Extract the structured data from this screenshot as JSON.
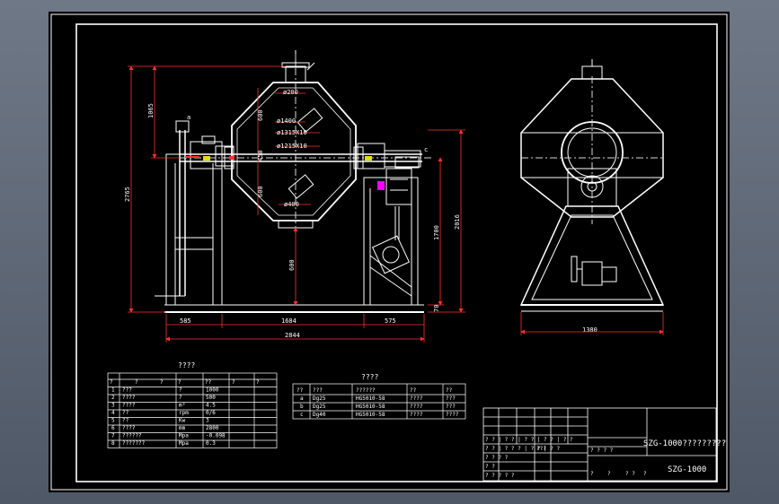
{
  "drawing": {
    "colors": {
      "background": "#000000",
      "frame": "#ffffff",
      "line": "#ffffff",
      "dim": "#ff3030",
      "accent": "#ff00ff",
      "center": "#d8d8d8"
    },
    "dimensions": {
      "d_top": "ø200",
      "d_140": "ø1400",
      "d_1315": "ø1315X10",
      "d_1215": "ø1215X10",
      "d_bottom": "ø400",
      "v_1065": "1065",
      "v_2765": "2765",
      "v_600a": "600",
      "v_450": "450",
      "v_600b": "600",
      "v_600c": "600",
      "v_1700": "1700",
      "v_2016": "2016",
      "v_70": "70",
      "h_585": "585",
      "h_1684": "1684",
      "h_575": "575",
      "h_2844": "2844",
      "h_1380": "1380",
      "tag_a": "a",
      "tag_c": "c"
    }
  },
  "specs_table": {
    "title": "????",
    "header": [
      "?",
      "?",
      "?",
      "?",
      "??",
      "?",
      "?"
    ],
    "rows": [
      [
        "1",
        "???",
        "?",
        "1000",
        "",
        ""
      ],
      [
        "2",
        "????",
        "?",
        "500",
        "",
        ""
      ],
      [
        "3",
        "????",
        "m³",
        "4.5",
        "",
        ""
      ],
      [
        "4",
        "??",
        "rpm",
        "0/6",
        "",
        ""
      ],
      [
        "5",
        "??",
        "Kw",
        "3",
        "",
        ""
      ],
      [
        "6",
        "????",
        "mm",
        "2800",
        "",
        ""
      ],
      [
        "7",
        "??????",
        "Mpa",
        "-0.098",
        "",
        ""
      ],
      [
        "8",
        "???????",
        "Mpa",
        "0.3",
        "",
        ""
      ]
    ]
  },
  "nozzle_table": {
    "title": "????",
    "header": [
      "??",
      "???",
      "??????",
      "??",
      "??"
    ],
    "rows": [
      [
        "a",
        "Dg25",
        "HG5010-58",
        "????",
        "???"
      ],
      [
        "b",
        "Dg25",
        "HG5010-58",
        "????",
        "???"
      ],
      [
        "c",
        "Dg40",
        "HG5010-58",
        "????",
        "????"
      ]
    ]
  },
  "title_block": {
    "main_title": "SZG-1000?????????",
    "drawing_no": "SZG-1000",
    "row1": "? ? | ? ? | ? ? | ? ? | ? ?",
    "row2": "? ? | ? ? ? | ? ? | ? ?",
    "row3a": "? ? ? ?",
    "row3b": "? ? ? ?",
    "row4": "? ?",
    "row5": "? ? ? ? ?",
    "row6a": "?",
    "row6b": "?",
    "row6c": "? ?",
    "row6d": "?",
    "row_part": "???"
  }
}
